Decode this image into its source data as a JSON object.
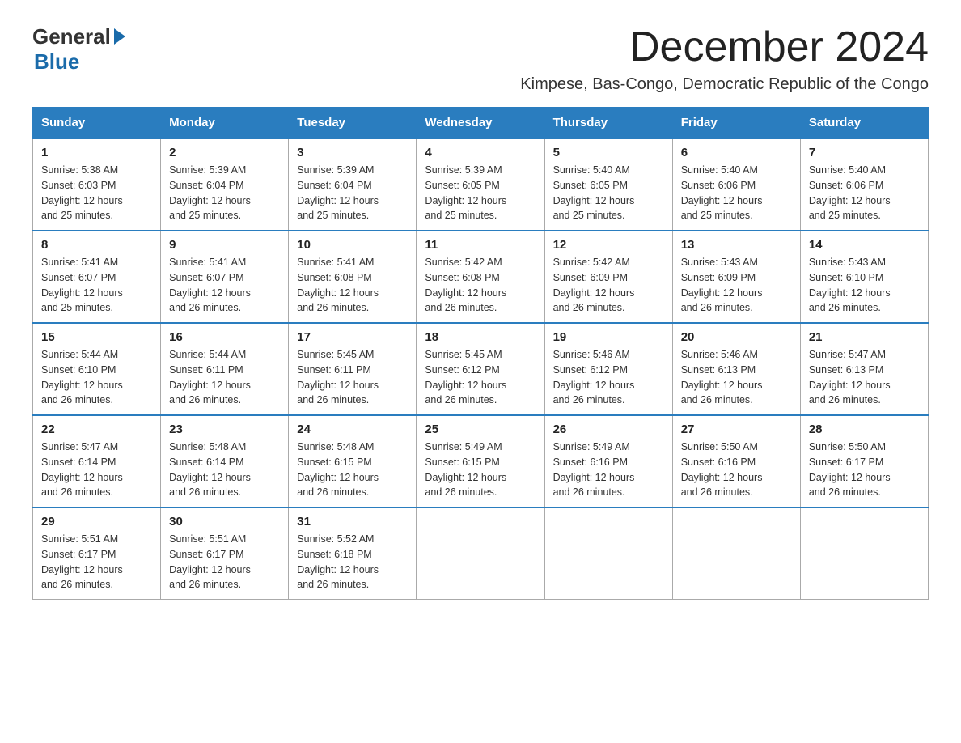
{
  "logo": {
    "general": "General",
    "blue": "Blue"
  },
  "title": "December 2024",
  "subtitle": "Kimpese, Bas-Congo, Democratic Republic of the Congo",
  "days_header": [
    "Sunday",
    "Monday",
    "Tuesday",
    "Wednesday",
    "Thursday",
    "Friday",
    "Saturday"
  ],
  "weeks": [
    [
      {
        "day": "1",
        "sunrise": "5:38 AM",
        "sunset": "6:03 PM",
        "daylight": "12 hours and 25 minutes."
      },
      {
        "day": "2",
        "sunrise": "5:39 AM",
        "sunset": "6:04 PM",
        "daylight": "12 hours and 25 minutes."
      },
      {
        "day": "3",
        "sunrise": "5:39 AM",
        "sunset": "6:04 PM",
        "daylight": "12 hours and 25 minutes."
      },
      {
        "day": "4",
        "sunrise": "5:39 AM",
        "sunset": "6:05 PM",
        "daylight": "12 hours and 25 minutes."
      },
      {
        "day": "5",
        "sunrise": "5:40 AM",
        "sunset": "6:05 PM",
        "daylight": "12 hours and 25 minutes."
      },
      {
        "day": "6",
        "sunrise": "5:40 AM",
        "sunset": "6:06 PM",
        "daylight": "12 hours and 25 minutes."
      },
      {
        "day": "7",
        "sunrise": "5:40 AM",
        "sunset": "6:06 PM",
        "daylight": "12 hours and 25 minutes."
      }
    ],
    [
      {
        "day": "8",
        "sunrise": "5:41 AM",
        "sunset": "6:07 PM",
        "daylight": "12 hours and 25 minutes."
      },
      {
        "day": "9",
        "sunrise": "5:41 AM",
        "sunset": "6:07 PM",
        "daylight": "12 hours and 26 minutes."
      },
      {
        "day": "10",
        "sunrise": "5:41 AM",
        "sunset": "6:08 PM",
        "daylight": "12 hours and 26 minutes."
      },
      {
        "day": "11",
        "sunrise": "5:42 AM",
        "sunset": "6:08 PM",
        "daylight": "12 hours and 26 minutes."
      },
      {
        "day": "12",
        "sunrise": "5:42 AM",
        "sunset": "6:09 PM",
        "daylight": "12 hours and 26 minutes."
      },
      {
        "day": "13",
        "sunrise": "5:43 AM",
        "sunset": "6:09 PM",
        "daylight": "12 hours and 26 minutes."
      },
      {
        "day": "14",
        "sunrise": "5:43 AM",
        "sunset": "6:10 PM",
        "daylight": "12 hours and 26 minutes."
      }
    ],
    [
      {
        "day": "15",
        "sunrise": "5:44 AM",
        "sunset": "6:10 PM",
        "daylight": "12 hours and 26 minutes."
      },
      {
        "day": "16",
        "sunrise": "5:44 AM",
        "sunset": "6:11 PM",
        "daylight": "12 hours and 26 minutes."
      },
      {
        "day": "17",
        "sunrise": "5:45 AM",
        "sunset": "6:11 PM",
        "daylight": "12 hours and 26 minutes."
      },
      {
        "day": "18",
        "sunrise": "5:45 AM",
        "sunset": "6:12 PM",
        "daylight": "12 hours and 26 minutes."
      },
      {
        "day": "19",
        "sunrise": "5:46 AM",
        "sunset": "6:12 PM",
        "daylight": "12 hours and 26 minutes."
      },
      {
        "day": "20",
        "sunrise": "5:46 AM",
        "sunset": "6:13 PM",
        "daylight": "12 hours and 26 minutes."
      },
      {
        "day": "21",
        "sunrise": "5:47 AM",
        "sunset": "6:13 PM",
        "daylight": "12 hours and 26 minutes."
      }
    ],
    [
      {
        "day": "22",
        "sunrise": "5:47 AM",
        "sunset": "6:14 PM",
        "daylight": "12 hours and 26 minutes."
      },
      {
        "day": "23",
        "sunrise": "5:48 AM",
        "sunset": "6:14 PM",
        "daylight": "12 hours and 26 minutes."
      },
      {
        "day": "24",
        "sunrise": "5:48 AM",
        "sunset": "6:15 PM",
        "daylight": "12 hours and 26 minutes."
      },
      {
        "day": "25",
        "sunrise": "5:49 AM",
        "sunset": "6:15 PM",
        "daylight": "12 hours and 26 minutes."
      },
      {
        "day": "26",
        "sunrise": "5:49 AM",
        "sunset": "6:16 PM",
        "daylight": "12 hours and 26 minutes."
      },
      {
        "day": "27",
        "sunrise": "5:50 AM",
        "sunset": "6:16 PM",
        "daylight": "12 hours and 26 minutes."
      },
      {
        "day": "28",
        "sunrise": "5:50 AM",
        "sunset": "6:17 PM",
        "daylight": "12 hours and 26 minutes."
      }
    ],
    [
      {
        "day": "29",
        "sunrise": "5:51 AM",
        "sunset": "6:17 PM",
        "daylight": "12 hours and 26 minutes."
      },
      {
        "day": "30",
        "sunrise": "5:51 AM",
        "sunset": "6:17 PM",
        "daylight": "12 hours and 26 minutes."
      },
      {
        "day": "31",
        "sunrise": "5:52 AM",
        "sunset": "6:18 PM",
        "daylight": "12 hours and 26 minutes."
      },
      null,
      null,
      null,
      null
    ]
  ],
  "labels": {
    "sunrise": "Sunrise:",
    "sunset": "Sunset:",
    "daylight": "Daylight:"
  }
}
